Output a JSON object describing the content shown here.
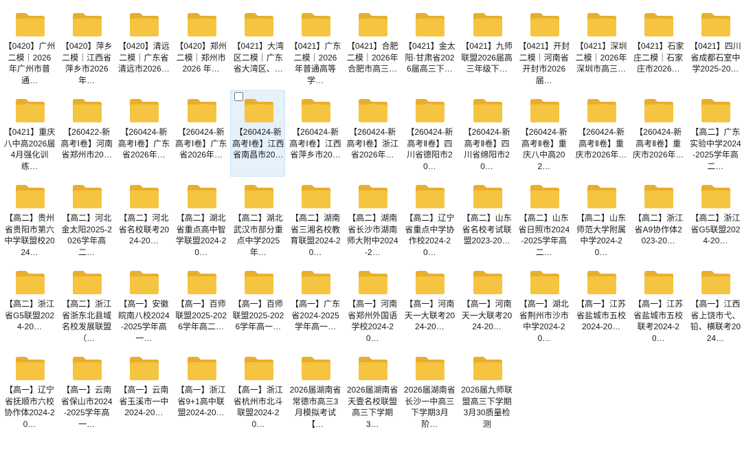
{
  "folder_color": "#f5c542",
  "folder_back_color": "#e9ae2b",
  "pdf_badge_color": "#e53935",
  "items": [
    {
      "label": "【0420】广州二模｜2026 年广州市普通…",
      "icon": "folder-pdf-icon"
    },
    {
      "label": "【0420】萍乡二模｜江西省萍乡市2026年…",
      "icon": "folder-pdf-icon"
    },
    {
      "label": "【0420】清远二模｜广东省清远市2026…",
      "icon": "folder-pdf-icon"
    },
    {
      "label": "【0420】郑州二模｜郑州市2026 年…",
      "icon": "folder-pdf-icon"
    },
    {
      "label": "【0421】大湾区二模｜广东省大湾区、…",
      "icon": "folder-pdf-icon"
    },
    {
      "label": "【0421】广东二模｜2026 年普通高等学…",
      "icon": "folder-pdf-icon"
    },
    {
      "label": "【0421】合肥二模｜2026年合肥市高三…",
      "icon": "folder-pdf-icon"
    },
    {
      "label": "【0421】金太阳·甘肃省2026届高三下…",
      "icon": "folder-pdf-icon"
    },
    {
      "label": "【0421】九师联盟2026届高三年级下…",
      "icon": "folder-pdf-icon"
    },
    {
      "label": "【0421】开封二模｜河南省开封市2026届…",
      "icon": "folder-pdf-icon"
    },
    {
      "label": "【0421】深圳二模｜2026年深圳市高三…",
      "icon": "folder-pdf-icon"
    },
    {
      "label": "【0421】石家庄二模｜石家庄市2026…",
      "icon": "folder-pdf-icon"
    },
    {
      "label": "【0421】四川省成都石室中学2025-20…",
      "icon": "folder-doc-icon"
    },
    {
      "label": "【0421】重庆八中高2026届4月强化训练…",
      "icon": "folder-pdf-icon"
    },
    {
      "label": "【260422-新高考Ⅰ卷】河南省郑州市20…",
      "icon": "folder-pdf-icon"
    },
    {
      "label": "【260424-新高考Ⅰ卷】广东省2026年…",
      "icon": "folder-pdf-icon"
    },
    {
      "label": "【260424-新高考Ⅰ卷】广东省2026年…",
      "icon": "folder-pdf-icon"
    },
    {
      "label": "【260424-新高考Ⅰ卷】江西省南昌市20…",
      "icon": "folder-pdf-icon",
      "selected": true
    },
    {
      "label": "【260424-新高考Ⅰ卷】江西省萍乡市20…",
      "icon": "folder-pdf-icon"
    },
    {
      "label": "【260424-新高考Ⅰ卷】浙江省2026年…",
      "icon": "folder-pdf-icon"
    },
    {
      "label": "【260424-新高考Ⅱ卷】四川省德阳市20…",
      "icon": "folder-pdf-icon"
    },
    {
      "label": "【260424-新高考Ⅱ卷】四川省绵阳市20…",
      "icon": "folder-pdf-icon"
    },
    {
      "label": "【260424-新高考Ⅱ卷】重庆八中高202…",
      "icon": "folder-pdf-icon"
    },
    {
      "label": "【260424-新高考Ⅱ卷】重庆市2026年…",
      "icon": "folder-pdf-icon"
    },
    {
      "label": "【260424-新高考Ⅱ卷】重庆市2026年…",
      "icon": "folder-pdf-icon"
    },
    {
      "label": "【高二】广东实验中学2024-2025学年高二…",
      "icon": "folder-icon"
    },
    {
      "label": "【高二】贵州省贵阳市第六中学联盟校2024…",
      "icon": "folder-icon"
    },
    {
      "label": "【高二】河北金太阳2025-2026学年高二…",
      "icon": "folder-icon"
    },
    {
      "label": "【高二】河北省名校联考2024-20…",
      "icon": "folder-icon"
    },
    {
      "label": "【高二】湖北省重点高中智学联盟2024-20…",
      "icon": "folder-icon"
    },
    {
      "label": "【高二】湖北武汉市部分重点中学2025年…",
      "icon": "folder-icon"
    },
    {
      "label": "【高二】湖南省三湘名校教育联盟2024-20…",
      "icon": "folder-icon"
    },
    {
      "label": "【高二】湖南省长沙市湖南师大附中2024-2…",
      "icon": "folder-icon"
    },
    {
      "label": "【高二】辽宁省重点中学协作校2024-20…",
      "icon": "folder-icon"
    },
    {
      "label": "【高二】山东省名校考试联盟2023-20…",
      "icon": "folder-icon"
    },
    {
      "label": "【高二】山东省日照市2024-2025学年高二…",
      "icon": "folder-icon"
    },
    {
      "label": "【高二】山东师范大学附属中学2024-20…",
      "icon": "folder-icon"
    },
    {
      "label": "【高二】浙江省A9协作体2023-20…",
      "icon": "folder-icon"
    },
    {
      "label": "【高二】浙江省G5联盟2024-20…",
      "icon": "folder-icon"
    },
    {
      "label": "【高二】浙江省G5联盟2024-20…",
      "icon": "folder-icon"
    },
    {
      "label": "【高二】浙江省浙东北县域名校发展联盟（…",
      "icon": "folder-icon"
    },
    {
      "label": "【高一】安徽皖南八校2024-2025学年高一…",
      "icon": "folder-icon"
    },
    {
      "label": "【高一】百师联盟2025-2026学年高二…",
      "icon": "folder-icon"
    },
    {
      "label": "【高一】百师联盟2025-2026学年高一…",
      "icon": "folder-icon"
    },
    {
      "label": "【高一】广东省2024-2025学年高一…",
      "icon": "folder-icon"
    },
    {
      "label": "【高一】河南省郑州外国语学校2024-20…",
      "icon": "folder-icon"
    },
    {
      "label": "【高一】河南天一大联考2024-20…",
      "icon": "folder-icon"
    },
    {
      "label": "【高一】河南天一大联考2024-20…",
      "icon": "folder-icon"
    },
    {
      "label": "【高一】湖北省荆州市沙市中学2024-20…",
      "icon": "folder-icon"
    },
    {
      "label": "【高一】江苏省盐城市五校2024-20…",
      "icon": "folder-icon"
    },
    {
      "label": "【高一】江苏省盐城市五校联考2024-20…",
      "icon": "folder-icon"
    },
    {
      "label": "【高一】江西省上饶市弋、铅、横联考2024…",
      "icon": "folder-icon"
    },
    {
      "label": "【高一】辽宁省抚顺市六校协作体2024-20…",
      "icon": "folder-icon"
    },
    {
      "label": "【高一】云南省保山市2024-2025学年高一…",
      "icon": "folder-icon"
    },
    {
      "label": "【高一】云南省玉溪市一中2024-20…",
      "icon": "folder-icon"
    },
    {
      "label": "【高一】浙江省9+1高中联盟2024-20…",
      "icon": "folder-icon"
    },
    {
      "label": "【高一】浙江省杭州市北斗联盟2024-20…",
      "icon": "folder-icon"
    },
    {
      "label": "2026届湖南省常德市高三3月模拟考试【…",
      "icon": "folder-icon"
    },
    {
      "label": "2026届湖南省天壹名校联盟高三下学期3…",
      "icon": "folder-icon"
    },
    {
      "label": "2026届湖南省长沙一中高三下学期3月阶…",
      "icon": "folder-icon"
    },
    {
      "label": "2026届九师联盟高三下学期3月30质量检测",
      "icon": "folder-icon"
    }
  ]
}
